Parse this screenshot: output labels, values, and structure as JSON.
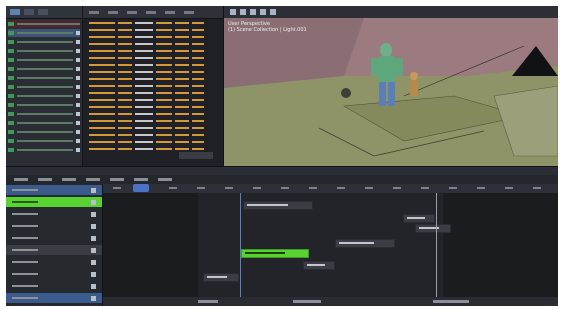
{
  "viewport": {
    "info_line1": "User Perspective",
    "info_line2": "(1) Scene Collection | Light.001"
  }
}
